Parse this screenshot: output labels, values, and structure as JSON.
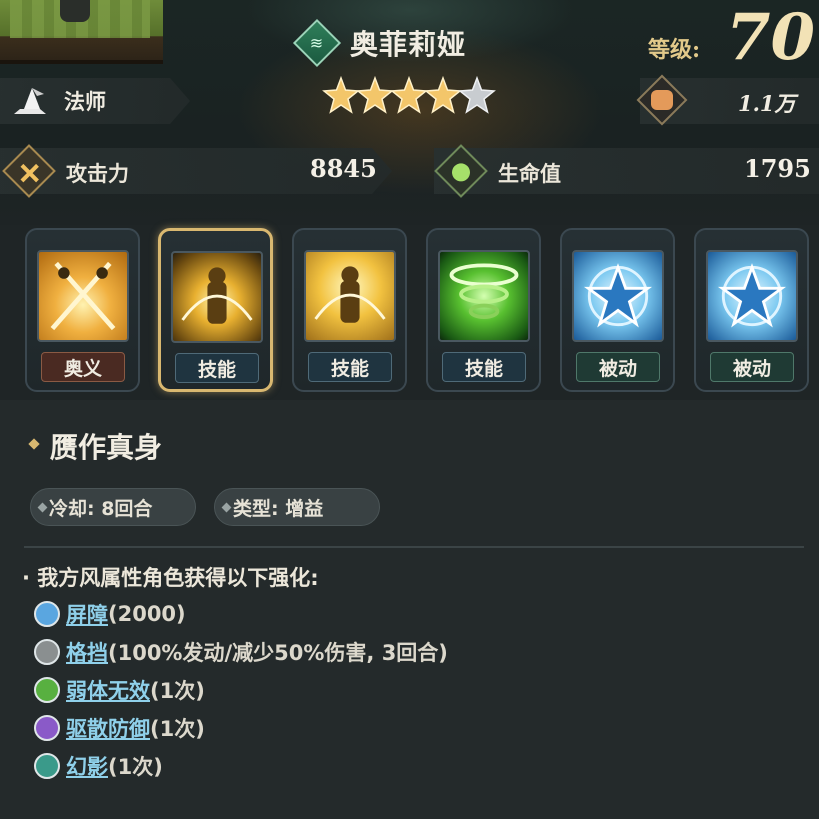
{
  "hero": {
    "name": "奥菲莉娅",
    "element_icon": "wind-element-icon",
    "level_label": "等级:",
    "level": "70",
    "stars_filled": 4,
    "stars_total": 5,
    "class_name": "法师",
    "power": "1.1万"
  },
  "stats": {
    "attack_label": "攻击力",
    "attack_value": "8845",
    "hp_label": "生命值",
    "hp_value": "1795"
  },
  "skills": [
    {
      "tag": "奥义",
      "type": "ult",
      "icon": "crossed-swords-skill-icon"
    },
    {
      "tag": "技能",
      "type": "skill",
      "icon": "golden-warrior-skill-icon",
      "selected": true
    },
    {
      "tag": "技能",
      "type": "skill",
      "icon": "radiant-figure-skill-icon"
    },
    {
      "tag": "技能",
      "type": "skill",
      "icon": "green-tornado-skill-icon"
    },
    {
      "tag": "被动",
      "type": "passive",
      "icon": "blue-star-skill-icon"
    },
    {
      "tag": "被动",
      "type": "passive",
      "icon": "blue-star-skill-icon"
    }
  ],
  "detail": {
    "title": "赝作真身",
    "cooldown": "冷却: 8回合",
    "type": "类型: 增益",
    "description": "· 我方风属性角色获得以下强化:",
    "effects": [
      {
        "name": "屏障",
        "detail": "(2000)",
        "icon": "barrier-icon",
        "color": "#5aa6e0"
      },
      {
        "name": "格挡",
        "detail": "(100%发动/减少50%伤害, 3回合)",
        "icon": "block-shield-icon",
        "color": "#8a8f90"
      },
      {
        "name": "弱体无效",
        "detail": "(1次)",
        "icon": "debuff-immune-icon",
        "color": "#58b040"
      },
      {
        "name": "驱散防御",
        "detail": "(1次)",
        "icon": "dispel-defense-icon",
        "color": "#8a5ac8"
      },
      {
        "name": "幻影",
        "detail": "(1次)",
        "icon": "phantom-icon",
        "color": "#3a9a8a"
      }
    ]
  }
}
